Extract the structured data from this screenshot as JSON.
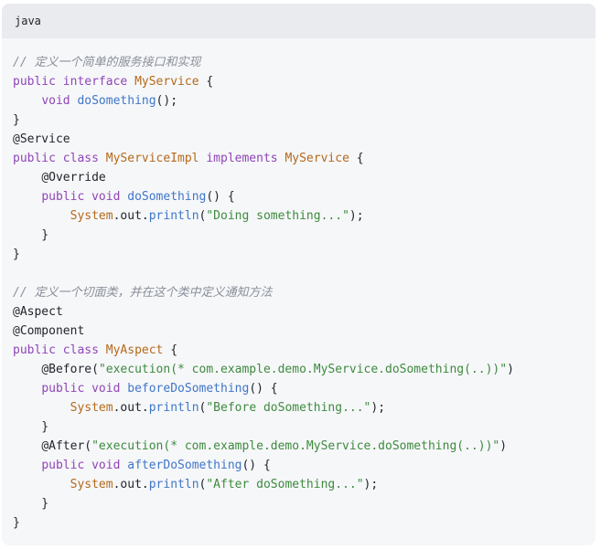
{
  "code_block": {
    "language": "java",
    "lines": [
      [
        {
          "t": "cm",
          "v": "// 定义一个简单的服务接口和实现"
        }
      ],
      [
        {
          "t": "kw",
          "v": "public"
        },
        {
          "t": "pl",
          "v": " "
        },
        {
          "t": "kw",
          "v": "interface"
        },
        {
          "t": "pl",
          "v": " "
        },
        {
          "t": "ty",
          "v": "MyService"
        },
        {
          "t": "pl",
          "v": " {"
        }
      ],
      [
        {
          "t": "pl",
          "v": "    "
        },
        {
          "t": "kw",
          "v": "void"
        },
        {
          "t": "pl",
          "v": " "
        },
        {
          "t": "fn",
          "v": "doSomething"
        },
        {
          "t": "pl",
          "v": "();"
        }
      ],
      [
        {
          "t": "pl",
          "v": "}"
        }
      ],
      [
        {
          "t": "an",
          "v": "@Service"
        }
      ],
      [
        {
          "t": "kw",
          "v": "public"
        },
        {
          "t": "pl",
          "v": " "
        },
        {
          "t": "kw",
          "v": "class"
        },
        {
          "t": "pl",
          "v": " "
        },
        {
          "t": "ty",
          "v": "MyServiceImpl"
        },
        {
          "t": "pl",
          "v": " "
        },
        {
          "t": "kw",
          "v": "implements"
        },
        {
          "t": "pl",
          "v": " "
        },
        {
          "t": "ty",
          "v": "MyService"
        },
        {
          "t": "pl",
          "v": " {"
        }
      ],
      [
        {
          "t": "pl",
          "v": "    "
        },
        {
          "t": "an",
          "v": "@Override"
        }
      ],
      [
        {
          "t": "pl",
          "v": "    "
        },
        {
          "t": "kw",
          "v": "public"
        },
        {
          "t": "pl",
          "v": " "
        },
        {
          "t": "kw",
          "v": "void"
        },
        {
          "t": "pl",
          "v": " "
        },
        {
          "t": "fn",
          "v": "doSomething"
        },
        {
          "t": "pl",
          "v": "() {"
        }
      ],
      [
        {
          "t": "pl",
          "v": "        "
        },
        {
          "t": "ty",
          "v": "System"
        },
        {
          "t": "pl",
          "v": ".out."
        },
        {
          "t": "fn",
          "v": "println"
        },
        {
          "t": "pl",
          "v": "("
        },
        {
          "t": "st",
          "v": "\"Doing something...\""
        },
        {
          "t": "pl",
          "v": ");"
        }
      ],
      [
        {
          "t": "pl",
          "v": "    }"
        }
      ],
      [
        {
          "t": "pl",
          "v": "}"
        }
      ],
      [
        {
          "t": "pl",
          "v": ""
        }
      ],
      [
        {
          "t": "cm",
          "v": "// 定义一个切面类，并在这个类中定义通知方法"
        }
      ],
      [
        {
          "t": "an",
          "v": "@Aspect"
        }
      ],
      [
        {
          "t": "an",
          "v": "@Component"
        }
      ],
      [
        {
          "t": "kw",
          "v": "public"
        },
        {
          "t": "pl",
          "v": " "
        },
        {
          "t": "kw",
          "v": "class"
        },
        {
          "t": "pl",
          "v": " "
        },
        {
          "t": "ty",
          "v": "MyAspect"
        },
        {
          "t": "pl",
          "v": " {"
        }
      ],
      [
        {
          "t": "pl",
          "v": "    "
        },
        {
          "t": "an",
          "v": "@Before"
        },
        {
          "t": "pl",
          "v": "("
        },
        {
          "t": "st",
          "v": "\"execution(* com.example.demo.MyService.doSomething(..))\""
        },
        {
          "t": "pl",
          "v": ")"
        }
      ],
      [
        {
          "t": "pl",
          "v": "    "
        },
        {
          "t": "kw",
          "v": "public"
        },
        {
          "t": "pl",
          "v": " "
        },
        {
          "t": "kw",
          "v": "void"
        },
        {
          "t": "pl",
          "v": " "
        },
        {
          "t": "fn",
          "v": "beforeDoSomething"
        },
        {
          "t": "pl",
          "v": "() {"
        }
      ],
      [
        {
          "t": "pl",
          "v": "        "
        },
        {
          "t": "ty",
          "v": "System"
        },
        {
          "t": "pl",
          "v": ".out."
        },
        {
          "t": "fn",
          "v": "println"
        },
        {
          "t": "pl",
          "v": "("
        },
        {
          "t": "st",
          "v": "\"Before doSomething...\""
        },
        {
          "t": "pl",
          "v": ");"
        }
      ],
      [
        {
          "t": "pl",
          "v": "    }"
        }
      ],
      [
        {
          "t": "pl",
          "v": "    "
        },
        {
          "t": "an",
          "v": "@After"
        },
        {
          "t": "pl",
          "v": "("
        },
        {
          "t": "st",
          "v": "\"execution(* com.example.demo.MyService.doSomething(..))\""
        },
        {
          "t": "pl",
          "v": ")"
        }
      ],
      [
        {
          "t": "pl",
          "v": "    "
        },
        {
          "t": "kw",
          "v": "public"
        },
        {
          "t": "pl",
          "v": " "
        },
        {
          "t": "kw",
          "v": "void"
        },
        {
          "t": "pl",
          "v": " "
        },
        {
          "t": "fn",
          "v": "afterDoSomething"
        },
        {
          "t": "pl",
          "v": "() {"
        }
      ],
      [
        {
          "t": "pl",
          "v": "        "
        },
        {
          "t": "ty",
          "v": "System"
        },
        {
          "t": "pl",
          "v": ".out."
        },
        {
          "t": "fn",
          "v": "println"
        },
        {
          "t": "pl",
          "v": "("
        },
        {
          "t": "st",
          "v": "\"After doSomething...\""
        },
        {
          "t": "pl",
          "v": ");"
        }
      ],
      [
        {
          "t": "pl",
          "v": "    }"
        }
      ],
      [
        {
          "t": "pl",
          "v": "}"
        }
      ]
    ]
  },
  "colors": {
    "block_bg": "#f6f7f9",
    "header_bg": "#e9ebee",
    "comment": "#8a8f99",
    "keyword": "#8f45b8",
    "type": "#b5691a",
    "function": "#3f76c8",
    "string": "#3e8a3e"
  }
}
